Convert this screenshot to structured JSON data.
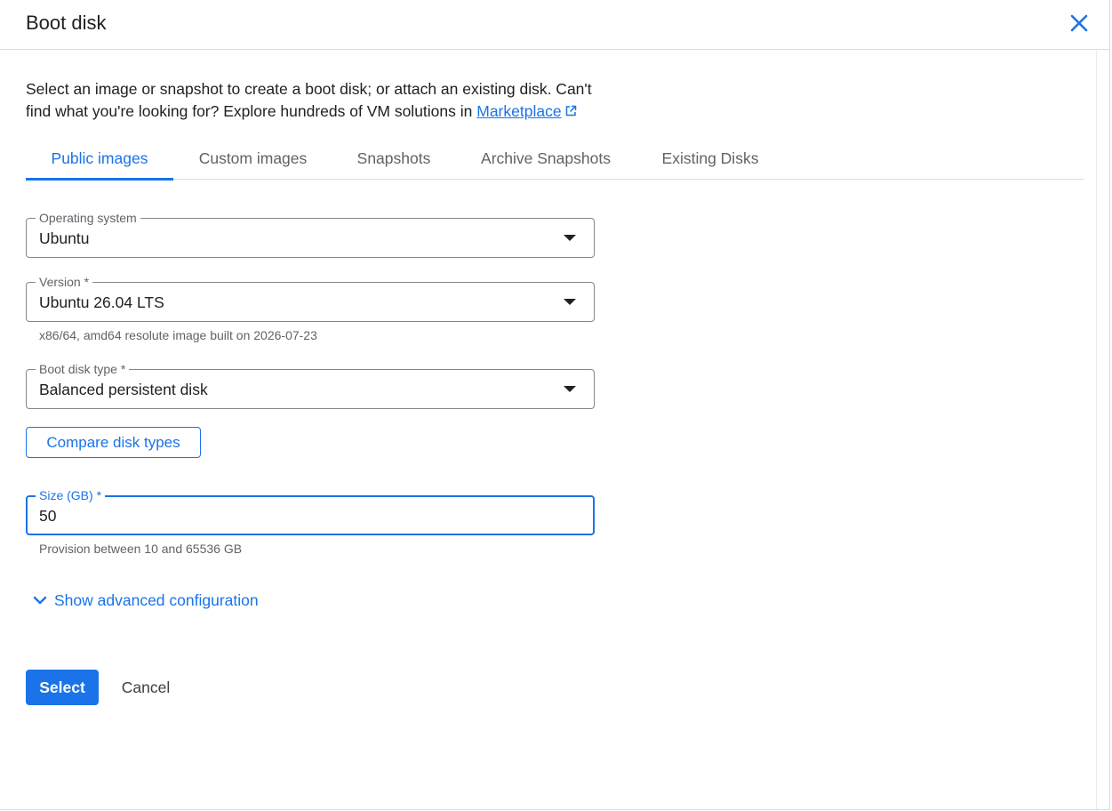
{
  "dialog": {
    "title": "Boot disk",
    "close_icon": "close-icon"
  },
  "description": {
    "text": "Select an image or snapshot to create a boot disk; or attach an existing disk. Can't find what you're looking for? Explore hundreds of VM solutions in ",
    "link_label": "Marketplace",
    "link_icon": "external-link-icon"
  },
  "tabs": [
    {
      "label": "Public images",
      "active": true
    },
    {
      "label": "Custom images",
      "active": false
    },
    {
      "label": "Snapshots",
      "active": false
    },
    {
      "label": "Archive Snapshots",
      "active": false
    },
    {
      "label": "Existing Disks",
      "active": false
    }
  ],
  "fields": {
    "operating_system": {
      "label": "Operating system",
      "value": "Ubuntu"
    },
    "version": {
      "label": "Version *",
      "value": "Ubuntu 26.04 LTS",
      "hint": "x86/64, amd64 resolute image built on 2026-07-23"
    },
    "boot_disk_type": {
      "label": "Boot disk type *",
      "value": "Balanced persistent disk"
    },
    "size": {
      "label": "Size (GB) *",
      "value": "50",
      "hint": "Provision between 10 and 65536 GB"
    }
  },
  "compare_button_label": "Compare disk types",
  "advanced_toggle_label": "Show advanced configuration",
  "actions": {
    "select_label": "Select",
    "cancel_label": "Cancel"
  },
  "colors": {
    "accent": "#1a73e8",
    "text": "#202124",
    "muted": "#5f6368",
    "border": "#dadce0"
  }
}
